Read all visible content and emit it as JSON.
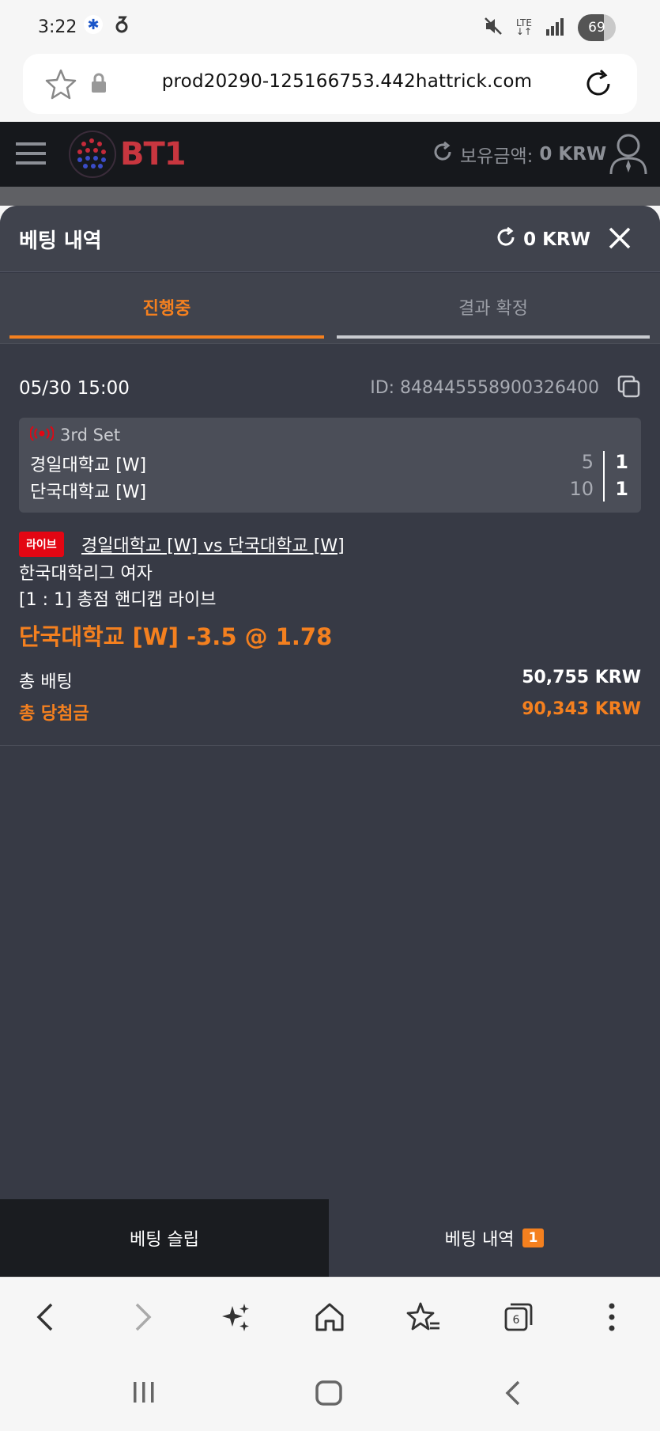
{
  "status_bar": {
    "time": "3:22",
    "battery": "69",
    "network": "LTE",
    "icons": [
      "asterisk-app-icon",
      "notification-icon",
      "mute-icon",
      "lte-icon",
      "signal-icon",
      "battery-icon"
    ]
  },
  "browser": {
    "url": "prod20290-125166753.442hattrick.com",
    "tab_count": "6"
  },
  "site_header": {
    "logo_text": "BT1",
    "balance_label": "보유금액:",
    "balance_value": "0 KRW"
  },
  "panel": {
    "title": "베팅 내역",
    "balance": "0 KRW",
    "tabs": [
      {
        "label": "진행중",
        "active": true
      },
      {
        "label": "결과 확정",
        "active": false
      }
    ]
  },
  "bet": {
    "date": "05/30 15:00",
    "id": "ID: 848445558900326400",
    "set": "3rd Set",
    "team1": "경일대학교 [W]",
    "team2": "단국대학교 [W]",
    "team1_points": "5",
    "team1_sets": "1",
    "team2_points": "10",
    "team2_sets": "1",
    "live_badge": "라이브",
    "match": "경일대학교 [W] vs 단국대학교 [W]",
    "league": "한국대학리그 여자",
    "market": "[1 : 1] 총점 핸디캡 라이브",
    "selection": "단국대학교 [W] -3.5 @ 1.78",
    "total_bet_label": "총 배팅",
    "total_bet_value": "50,755 KRW",
    "total_win_label": "총 당첨금",
    "total_win_value": "90,343 KRW"
  },
  "bottom_tabs": {
    "slip_label": "베팅 슬립",
    "history_label": "베팅 내역",
    "history_count": "1"
  },
  "colors": {
    "accent": "#f4801f",
    "panel_bg": "#373a45",
    "header_bg": "#16181c",
    "live_red": "#e30613"
  }
}
